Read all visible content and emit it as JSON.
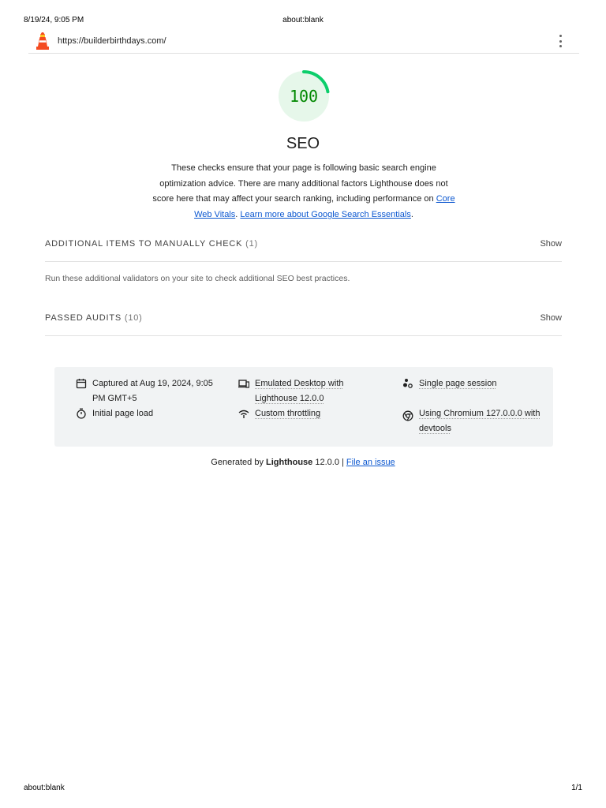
{
  "print_header": {
    "datetime": "8/19/24, 9:05 PM",
    "title": "about:blank"
  },
  "print_footer": {
    "url": "about:blank",
    "page": "1/1"
  },
  "topbar": {
    "url": "https://builderbirthdays.com/",
    "logo_icon": "lighthouse-icon",
    "menu_icon": "kebab-menu-icon"
  },
  "gauge": {
    "score": "100",
    "fraction": 1.0,
    "color": "#0cce6b",
    "fill": "#e6f7ea",
    "text_color": "#008800"
  },
  "category": {
    "title": "SEO",
    "description_text": "These checks ensure that your page is following basic search engine optimization advice. There are many additional factors Lighthouse does not score here that may affect your search ranking, including performance on",
    "link_core_web_vitals": "Core Web Vitals",
    "separator": ".",
    "link_search_essentials": "Learn more about Google Search Essentials",
    "end": "."
  },
  "groups": [
    {
      "title": "Additional items to manually check",
      "count": "(1)",
      "show_label": "Show"
    },
    {
      "title": "Passed audits",
      "count": "(10)",
      "show_label": "Show"
    }
  ],
  "manual_description": "Run these additional validators on your site to check additional SEO best practices.",
  "meta": {
    "captured": {
      "icon": "calendar-icon",
      "text": "Captured at Aug 19, 2024, 9:05 PM GMT+5"
    },
    "emulated": {
      "icon": "devices-icon",
      "text": "Emulated Desktop with Lighthouse 12.0.0"
    },
    "session": {
      "icon": "users-icon",
      "text": "Single page session"
    },
    "load": {
      "icon": "stopwatch-icon",
      "text": "Initial page load"
    },
    "throttling": {
      "icon": "wifi-icon",
      "text": "Custom throttling"
    },
    "chromium": {
      "icon": "chrome-icon",
      "text": "Using Chromium 127.0.0.0 with devtools"
    }
  },
  "footer": {
    "generated_by": "Generated by",
    "brand": "Lighthouse",
    "version": "12.0.0 |",
    "issue_link": "File an issue"
  }
}
